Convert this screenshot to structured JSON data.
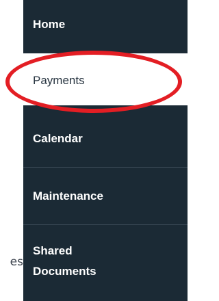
{
  "sidebar": {
    "items": [
      {
        "id": "home",
        "label": "Home",
        "active": false
      },
      {
        "id": "payments",
        "label": "Payments",
        "active": true
      },
      {
        "id": "calendar",
        "label": "Calendar",
        "active": false
      },
      {
        "id": "maintenance",
        "label": "Maintenance",
        "active": false
      },
      {
        "id": "shared-documents",
        "label_line1": "Shared",
        "label_line2": "Documents",
        "active": false
      }
    ]
  },
  "background_fragment": "es",
  "colors": {
    "sidebar_bg": "#1b2a35",
    "active_bg": "#ffffff",
    "annotation": "#e31e24"
  }
}
